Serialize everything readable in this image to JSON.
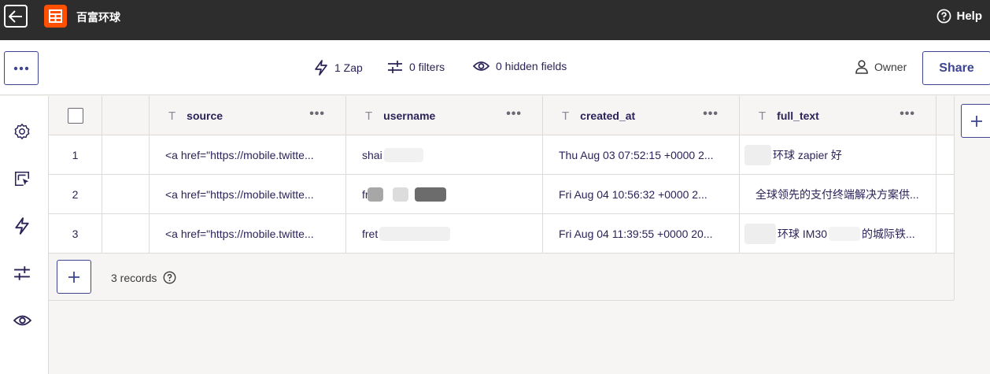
{
  "topbar": {
    "app_title": "百富环球",
    "help_label": "Help"
  },
  "toolbar": {
    "zap_label": "1 Zap",
    "filters_label": "0 filters",
    "hidden_label": "0 hidden fields",
    "owner_label": "Owner",
    "share_label": "Share"
  },
  "table": {
    "columns": [
      {
        "name": "source"
      },
      {
        "name": "username"
      },
      {
        "name": "created_at"
      },
      {
        "name": "full_text"
      }
    ],
    "rows": [
      {
        "num": "1",
        "source": "<a href=\"https://mobile.twitte...",
        "username": "shai",
        "created_at": "Thu Aug 03 07:52:15 +0000 2...",
        "full_text": "环球 zapier 好"
      },
      {
        "num": "2",
        "source": "<a href=\"https://mobile.twitte...",
        "username": "fr",
        "created_at": "Fri Aug 04 10:56:32 +0000 2...",
        "full_text": "全球领先的支付终端解决方案供..."
      },
      {
        "num": "3",
        "source": "<a href=\"https://mobile.twitte...",
        "username": "fret",
        "created_at": "Fri Aug 04 11:39:55 +0000 20...",
        "full_text_a": "环球 IM30",
        "full_text_b": "的城际铁..."
      }
    ]
  },
  "footer": {
    "records_label": "3 records"
  },
  "icons": {
    "back": "back-arrow-icon",
    "logo": "table-icon",
    "help": "help-circle-icon",
    "settings": "gear-icon",
    "views": "cursor-panel-icon",
    "zap": "lightning-icon",
    "filters": "filter-sliders-icon",
    "hidden": "eye-icon"
  },
  "colors": {
    "topbar": "#2d2d2d",
    "brand": "#ff4f00",
    "accent": "#3d4592"
  }
}
